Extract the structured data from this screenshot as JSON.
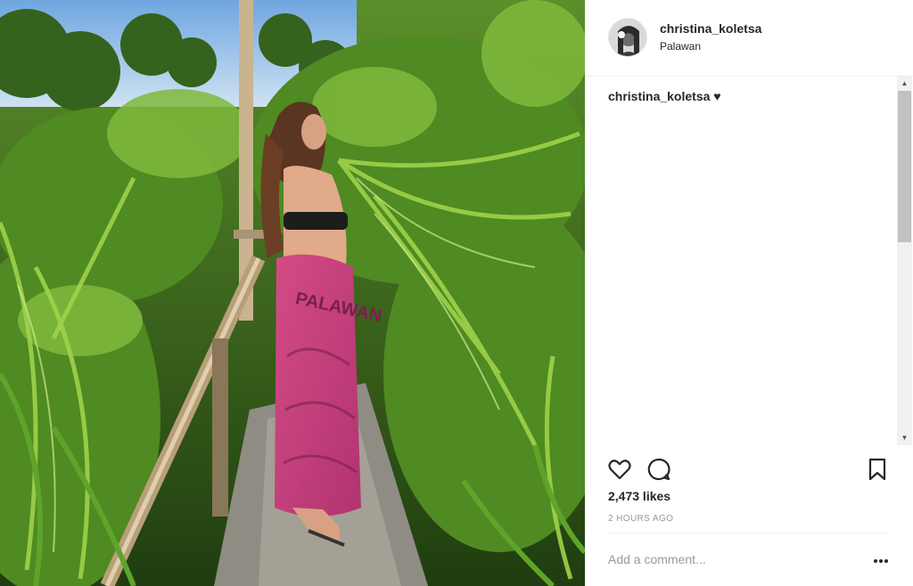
{
  "post": {
    "username": "christina_koletsa",
    "location": "Palawan",
    "caption_user": "christina_koletsa",
    "caption_text": "♥",
    "likes": "2,473 likes",
    "time": "2 HOURS AGO",
    "sarong_text": "PALAWAN"
  },
  "comment": {
    "placeholder": "Add a comment..."
  },
  "icons": {
    "like": "heart-outline-icon",
    "comment": "speech-bubble-icon",
    "save": "bookmark-icon",
    "more": "more-options-icon"
  },
  "colors": {
    "text": "#262626",
    "muted": "#999999",
    "divider": "#efefef"
  }
}
